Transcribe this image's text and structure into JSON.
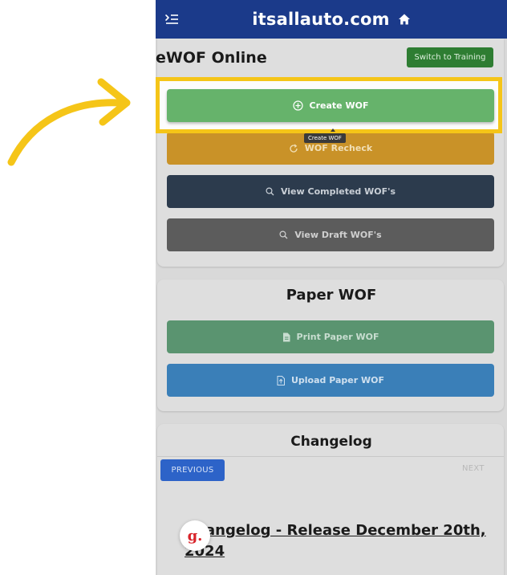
{
  "topbar": {
    "brand": "itsallauto.com",
    "color": "#1b3a8a"
  },
  "ewof": {
    "title": "eWOF Online",
    "switch_label": "Switch to Training",
    "create_label": "Create WOF",
    "recheck_label": "WOF Recheck",
    "completed_label": "View Completed WOF's",
    "draft_label": "View Draft WOF's",
    "tooltip": "Create WOF"
  },
  "paper": {
    "title": "Paper WOF",
    "print_label": "Print Paper WOF",
    "upload_label": "Upload Paper WOF"
  },
  "changelog": {
    "title": "Changelog",
    "prev_label": "PREVIOUS",
    "next_label": "NEXT",
    "entry_label": "Changelog - Release December 20th, 2024"
  },
  "badge": {
    "letter": "g."
  },
  "annotation": {
    "highlight_color": "#f5c518"
  }
}
